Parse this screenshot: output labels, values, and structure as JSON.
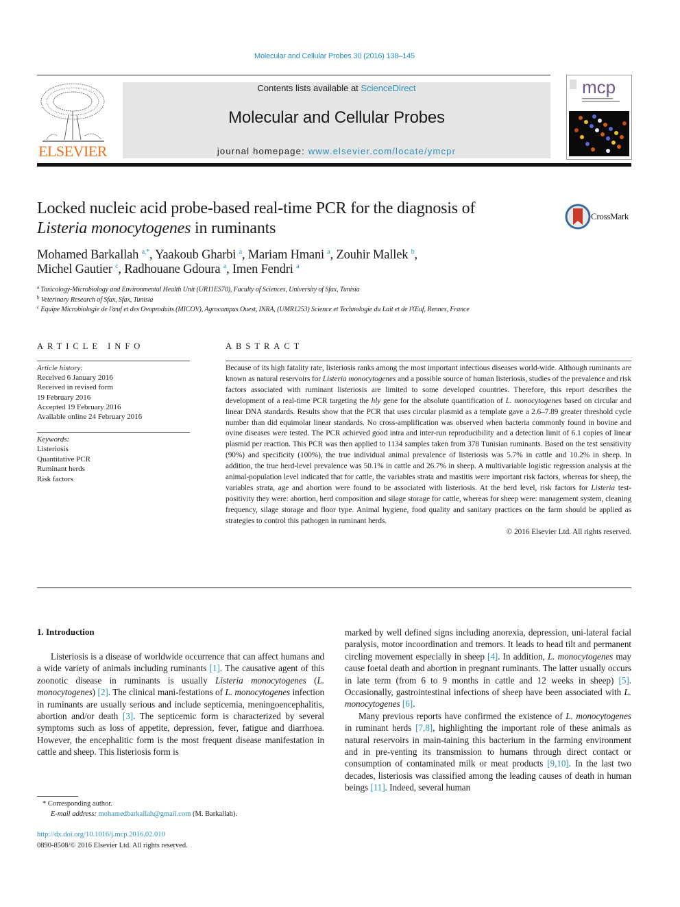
{
  "citation": "Molecular and Cellular Probes 30 (2016) 138–145",
  "header": {
    "publisher": "ELSEVIER",
    "contents_prefix": "Contents lists available at ",
    "contents_link": "ScienceDirect",
    "journal_name": "Molecular and Cellular Probes",
    "homepage_prefix": "journal homepage: ",
    "homepage_link": "www.elsevier.com/locate/ymcpr",
    "cover_logo": "mcp"
  },
  "colors": {
    "link": "#2a8fb8",
    "elsevier_orange": "#e9711c",
    "header_bg": "#e6e6e6"
  },
  "title": {
    "line1": "Locked nucleic acid probe-based real-time PCR for the diagnosis of",
    "line2_italic": "Listeria monocytogenes",
    "line2_rest": " in ruminants"
  },
  "crossmark_label": "CrossMark",
  "authors": [
    {
      "name": "Mohamed Barkallah",
      "aff": "a,",
      "star": "*",
      "sep": ", "
    },
    {
      "name": "Yaakoub Gharbi",
      "aff": "a",
      "sep": ", "
    },
    {
      "name": "Mariam Hmani",
      "aff": "a",
      "sep": ", "
    },
    {
      "name": "Zouhir Mallek",
      "aff": "b",
      "sep": ","
    },
    {
      "name": "Michel Gautier",
      "aff": "c",
      "sep": ", "
    },
    {
      "name": "Radhouane Gdoura",
      "aff": "a",
      "sep": ", "
    },
    {
      "name": "Imen Fendri",
      "aff": "a",
      "sep": ""
    }
  ],
  "affiliations": [
    {
      "key": "a",
      "text": "Toxicology-Microbiology and Environmental Health Unit (UR11ES70), Faculty of Sciences, University of Sfax, Tunisia"
    },
    {
      "key": "b",
      "text": "Veterinary Research of Sfax, Sfax, Tunisia"
    },
    {
      "key": "c",
      "text": "Equipe Microbiologie de l'œuf et des Ovoproduits (MICOV), Agrocampus Ouest, INRA, (UMR1253) Science et Technologie du Lait et de l'Œuf, Rennes, France"
    }
  ],
  "article_info": {
    "heading": "ARTICLE INFO",
    "history_label": "Article history:",
    "history": [
      "Received 6 January 2016",
      "Received in revised form",
      "19 February 2016",
      "Accepted 19 February 2016",
      "Available online 24 February 2016"
    ],
    "keywords_label": "Keywords:",
    "keywords": [
      "Listeriosis",
      "Quantitative PCR",
      "Ruminant herds",
      "Risk factors"
    ]
  },
  "abstract": {
    "heading": "ABSTRACT",
    "s1": "Because of its high fatality rate, listeriosis ranks among the most important infectious diseases world-wide. Although ruminants are known as natural reservoirs for ",
    "s1_i": "Listeria monocytogenes",
    "s2": " and a possible source of human listeriosis, studies of the prevalence and risk factors associated with ruminant listeriosis are limited to some developed countries. Therefore, this report describes the development of a real-time PCR targeting the ",
    "s2_i": "hly",
    "s3": " gene for the absolute quantification of ",
    "s3_i": "L. monocytogenes",
    "s4": " based on circular and linear DNA standards. Results show that the PCR that uses circular plasmid as a template gave a 2.6–7.89 greater threshold cycle number than did equimolar linear standards. No cross-amplification was observed when bacteria commonly found in bovine and ovine diseases were tested. The PCR achieved good intra and inter-run reproducibility and a detection limit of 6.1 copies of linear plasmid per reaction. This PCR was then applied to 1134 samples taken from 378 Tunisian ruminants. Based on the test sensitivity (90%) and specificity (100%), the true individual animal prevalence of listeriosis was 5.7% in cattle and 10.2% in sheep. In addition, the true herd-level prevalence was 50.1% in cattle and 26.7% in sheep. A multivariable logistic regression analysis at the animal-population level indicated that for cattle, the variables strata and mastitis were important risk factors, whereas for sheep, the variables strata, age and abortion were found to be associated with listeriosis. At the herd level, risk factors for ",
    "s4_i": "Listeria",
    "s5": " test-positivity they were: abortion, herd composition and silage storage for cattle, whereas for sheep were: management system, cleaning frequency, silage storage and floor type. Animal hygiene, food quality and sanitary practices on the farm should be applied as strategies to control this pathogen in ruminant herds.",
    "copyright": "© 2016 Elsevier Ltd. All rights reserved."
  },
  "intro": {
    "heading": "1.  Introduction",
    "p1": [
      {
        "t": "Listeriosis is a disease of worldwide occurrence that can affect humans and a wide variety of animals including ruminants "
      },
      {
        "r": "[1]"
      },
      {
        "t": ". The causative agent of this zoonotic disease in ruminants is usually "
      },
      {
        "i": "Listeria monocytogenes"
      },
      {
        "t": " ("
      },
      {
        "i": "L. monocytogenes"
      },
      {
        "t": ") "
      },
      {
        "r": "[2]"
      },
      {
        "t": ". The clinical mani-festations of "
      },
      {
        "i": "L. monocytogenes"
      },
      {
        "t": " infection in ruminants are usually serious and include septicemia, meningoencephalitis, abortion and/or death "
      },
      {
        "r": "[3]"
      },
      {
        "t": ". The septicemic form is characterized by several symptoms such as loss of appetite, depression, fever, fatigue and diarrhoea. However, the encephalitic form is the most frequent disease manifestation in cattle and sheep. This listeriosis form is"
      }
    ],
    "p1_cont": [
      {
        "t": "marked by well defined signs including anorexia, depression, uni-lateral facial paralysis, motor incoordination and tremors. It leads to head tilt and permanent circling movement especially in sheep "
      },
      {
        "r": "[4]"
      },
      {
        "t": ". In addition, "
      },
      {
        "i": "L. monocytogenes"
      },
      {
        "t": " may cause foetal death and abortion in pregnant ruminants. The latter usually occurs in late term (from 6 to 9 months in cattle and 12 weeks in sheep) "
      },
      {
        "r": "[5]"
      },
      {
        "t": ". Occasionally, gastrointestinal infections of sheep have been associated with "
      },
      {
        "i": "L. monocytogenes"
      },
      {
        "t": " "
      },
      {
        "r": "[6]"
      },
      {
        "t": "."
      }
    ],
    "p2": [
      {
        "t": "Many previous reports have confirmed the existence of "
      },
      {
        "i": "L. monocytogenes"
      },
      {
        "t": " in ruminant herds "
      },
      {
        "r": "[7,8]"
      },
      {
        "t": ", highlighting the important role of these animals as natural reservoirs in main-taining this bacterium in the farming environment and in pre-venting its transmission to humans through direct contact or consumption of contaminated milk or meat products "
      },
      {
        "r": "[9,10]"
      },
      {
        "t": ". In the last two decades, listeriosis was classified among the leading causes of death in human beings "
      },
      {
        "r": "[11]"
      },
      {
        "t": ". Indeed, several human"
      }
    ]
  },
  "footnote": {
    "star_text": "* Corresponding author.",
    "email_label": "E-mail address: ",
    "email": "mohamedbarkallah@gmail.com",
    "email_suffix": " (M. Barkallah)."
  },
  "doi": {
    "link": "http://dx.doi.org/10.1016/j.mcp.2016.02.010",
    "issn_line": "0890-8508/© 2016 Elsevier Ltd. All rights reserved."
  }
}
